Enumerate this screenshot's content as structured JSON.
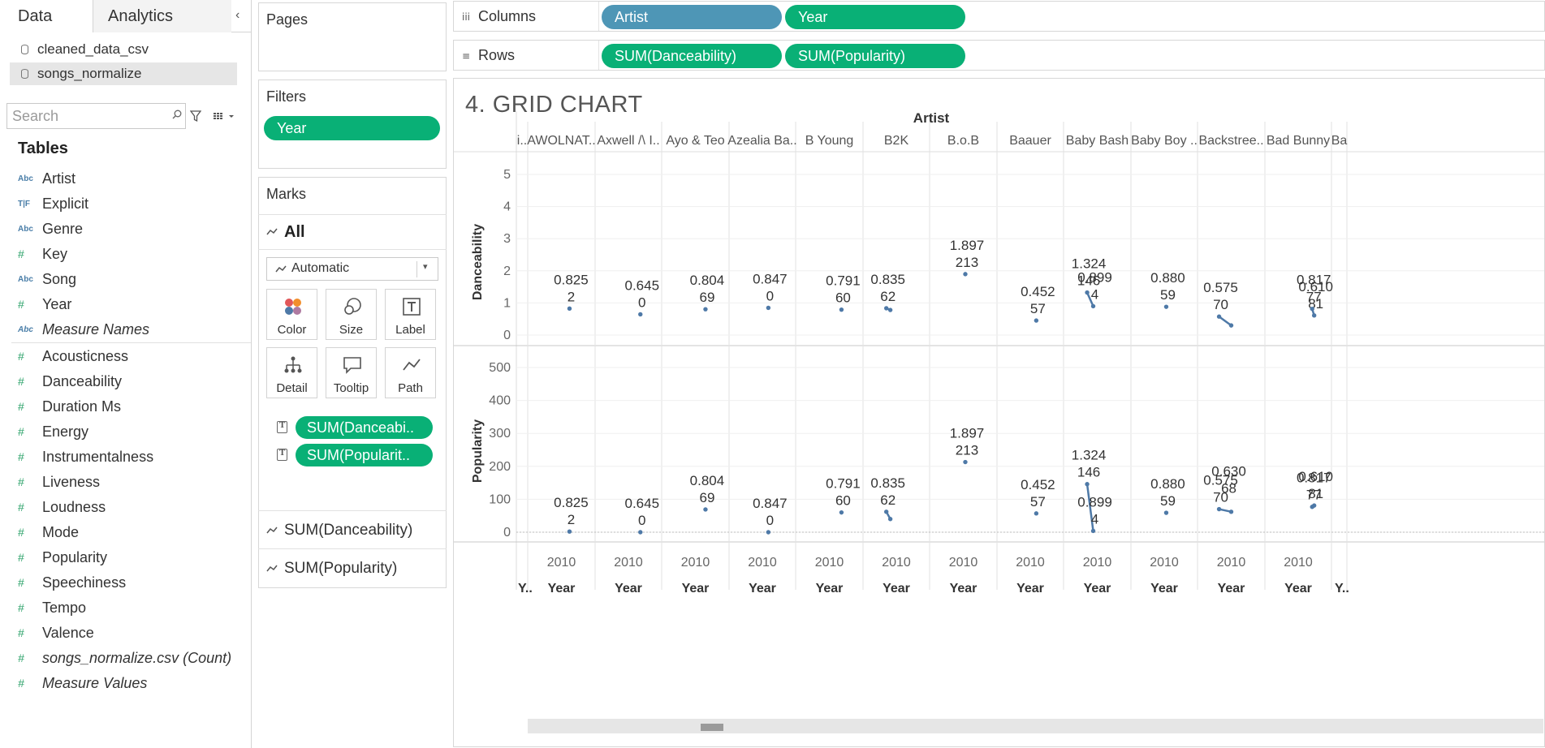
{
  "data_pane": {
    "tabs": [
      "Data",
      "Analytics"
    ],
    "collapse_glyph": "‹",
    "datasources": [
      "cleaned_data_csv",
      "songs_normalize"
    ],
    "search_placeholder": "Search",
    "tables_heading": "Tables",
    "dimensions": [
      {
        "type": "Abc",
        "name": "Artist"
      },
      {
        "type": "T|F",
        "name": "Explicit"
      },
      {
        "type": "Abc",
        "name": "Genre"
      },
      {
        "type": "#",
        "name": "Key"
      },
      {
        "type": "Abc",
        "name": "Song"
      },
      {
        "type": "#",
        "name": "Year"
      },
      {
        "type": "Abc",
        "name": "Measure Names"
      }
    ],
    "measures": [
      {
        "type": "#",
        "name": "Acousticness"
      },
      {
        "type": "#",
        "name": "Danceability"
      },
      {
        "type": "#",
        "name": "Duration Ms"
      },
      {
        "type": "#",
        "name": "Energy"
      },
      {
        "type": "#",
        "name": "Instrumentalness"
      },
      {
        "type": "#",
        "name": "Liveness"
      },
      {
        "type": "#",
        "name": "Loudness"
      },
      {
        "type": "#",
        "name": "Mode"
      },
      {
        "type": "#",
        "name": "Popularity"
      },
      {
        "type": "#",
        "name": "Speechiness"
      },
      {
        "type": "#",
        "name": "Tempo"
      },
      {
        "type": "#",
        "name": "Valence"
      },
      {
        "type": "#",
        "name": "songs_normalize.csv (Count)"
      },
      {
        "type": "#",
        "name": "Measure Values"
      }
    ]
  },
  "pages": {
    "title": "Pages"
  },
  "filters": {
    "title": "Filters",
    "pills": [
      "Year"
    ]
  },
  "marks": {
    "title": "Marks",
    "all_label": "All",
    "mark_type": "Automatic",
    "buttons": [
      "Color",
      "Size",
      "Label",
      "Detail",
      "Tooltip",
      "Path"
    ],
    "fields": [
      "SUM(Danceabi..",
      "SUM(Popularit.."
    ],
    "sub_cards": [
      "SUM(Danceability)",
      "SUM(Popularity)"
    ]
  },
  "shelves": {
    "columns": {
      "title": "Columns",
      "pills": [
        "Artist",
        "Year"
      ]
    },
    "rows": {
      "title": "Rows",
      "pills": [
        "SUM(Danceability)",
        "SUM(Popularity)"
      ]
    }
  },
  "colors": {
    "pill_green": "#09b076",
    "pill_blue": "#4e96b6",
    "mark_blue": "#4e79a7"
  },
  "sheet": {
    "title": "4. GRID CHART"
  },
  "chart_data": {
    "type": "line",
    "column_header_title": "Artist",
    "columns": [
      {
        "artist": "...",
        "header": "i..",
        "year_label": "Y.."
      },
      {
        "artist": "AWOLNATION",
        "header": "AWOLNAT..",
        "year_label": "Year"
      },
      {
        "artist": "Axwell /\\ Ingrosso",
        "header": "Axwell /\\ I..",
        "year_label": "Year"
      },
      {
        "artist": "Ayo & Teo",
        "header": "Ayo & Teo",
        "year_label": "Year"
      },
      {
        "artist": "Azealia Banks",
        "header": "Azealia Ba..",
        "year_label": "Year"
      },
      {
        "artist": "B Young",
        "header": "B Young",
        "year_label": "Year"
      },
      {
        "artist": "B2K",
        "header": "B2K",
        "year_label": "Year"
      },
      {
        "artist": "B.o.B",
        "header": "B.o.B",
        "year_label": "Year"
      },
      {
        "artist": "Baauer",
        "header": "Baauer",
        "year_label": "Year"
      },
      {
        "artist": "Baby Bash",
        "header": "Baby Bash",
        "year_label": "Year"
      },
      {
        "artist": "Baby Boy",
        "header": "Baby Boy ..",
        "year_label": "Year"
      },
      {
        "artist": "Backstreet Boys",
        "header": "Backstree..",
        "year_label": "Year"
      },
      {
        "artist": "Bad Bunny",
        "header": "Bad Bunny",
        "year_label": "Year"
      },
      {
        "artist": "Ba...",
        "header": "Ba",
        "year_label": "Y.."
      }
    ],
    "x_tick_label": "2010",
    "rows": [
      {
        "measure": "Danceability",
        "ylim": [
          0,
          5
        ],
        "ticks": [
          0,
          1,
          2,
          3,
          4,
          5
        ]
      },
      {
        "measure": "Popularity",
        "ylim": [
          0,
          500
        ],
        "ticks": [
          0,
          100,
          200,
          300,
          400,
          500
        ]
      }
    ],
    "series": [
      {
        "name": "AWOLNATION",
        "points": [
          {
            "year": 2010.4,
            "danceability": 0.825,
            "popularity": 2,
            "label": [
              "0.825",
              "2"
            ]
          }
        ]
      },
      {
        "name": "Axwell /\\ Ingrosso",
        "points": [
          {
            "year": 2010.6,
            "danceability": 0.645,
            "popularity": 0,
            "label": [
              "0.645",
              "0"
            ]
          }
        ]
      },
      {
        "name": "Ayo & Teo",
        "points": [
          {
            "year": 2010.5,
            "danceability": 0.804,
            "popularity": 69,
            "label": [
              "0.804",
              "69"
            ]
          }
        ]
      },
      {
        "name": "Azealia Banks",
        "points": [
          {
            "year": 2010.3,
            "danceability": 0.847,
            "popularity": 0,
            "label": [
              "0.847",
              "0"
            ]
          }
        ]
      },
      {
        "name": "B Young",
        "points": [
          {
            "year": 2010.6,
            "danceability": 0.791,
            "popularity": 60,
            "label": [
              "0.791",
              "60"
            ]
          }
        ]
      },
      {
        "name": "B2K",
        "points": [
          {
            "year": 2009.5,
            "danceability": 0.835,
            "popularity": 62,
            "label": [
              "0.835",
              "62"
            ]
          },
          {
            "year": 2009.7,
            "danceability": 0.78,
            "popularity": 40,
            "label": null
          }
        ]
      },
      {
        "name": "B.o.B",
        "points": [
          {
            "year": 2010.1,
            "danceability": 1.897,
            "popularity": 213,
            "label": [
              "1.897",
              "213"
            ]
          }
        ]
      },
      {
        "name": "Baauer",
        "points": [
          {
            "year": 2010.3,
            "danceability": 0.452,
            "popularity": 57,
            "label": [
              "0.452",
              "57"
            ]
          }
        ]
      },
      {
        "name": "Baby Bash",
        "points": [
          {
            "year": 2009.5,
            "danceability": 1.324,
            "popularity": 146,
            "label": [
              "1.324",
              "146"
            ]
          },
          {
            "year": 2009.8,
            "danceability": 0.899,
            "popularity": 4,
            "label": [
              "0.899",
              "4"
            ]
          }
        ]
      },
      {
        "name": "Baby Boy",
        "points": [
          {
            "year": 2010.1,
            "danceability": 0.88,
            "popularity": 59,
            "label": [
              "0.880",
              "59"
            ]
          }
        ]
      },
      {
        "name": "Backstreet Boys",
        "points": [
          {
            "year": 2009.4,
            "danceability": 0.575,
            "popularity": 70,
            "label": [
              "0.575",
              "70"
            ]
          },
          {
            "year": 2010.0,
            "danceability": 0.3,
            "popularity": 62,
            "label": null
          }
        ],
        "extra_labels": [
          [
            "0.630",
            "68"
          ]
        ]
      },
      {
        "name": "Bad Bunny",
        "points": [
          {
            "year": 2010.8,
            "danceability": 0.61,
            "popularity": 81,
            "label": [
              "0.610",
              "81"
            ]
          },
          {
            "year": 2010.7,
            "danceability": 0.817,
            "popularity": 77,
            "label": [
              "0.817",
              "77"
            ]
          }
        ]
      }
    ]
  }
}
